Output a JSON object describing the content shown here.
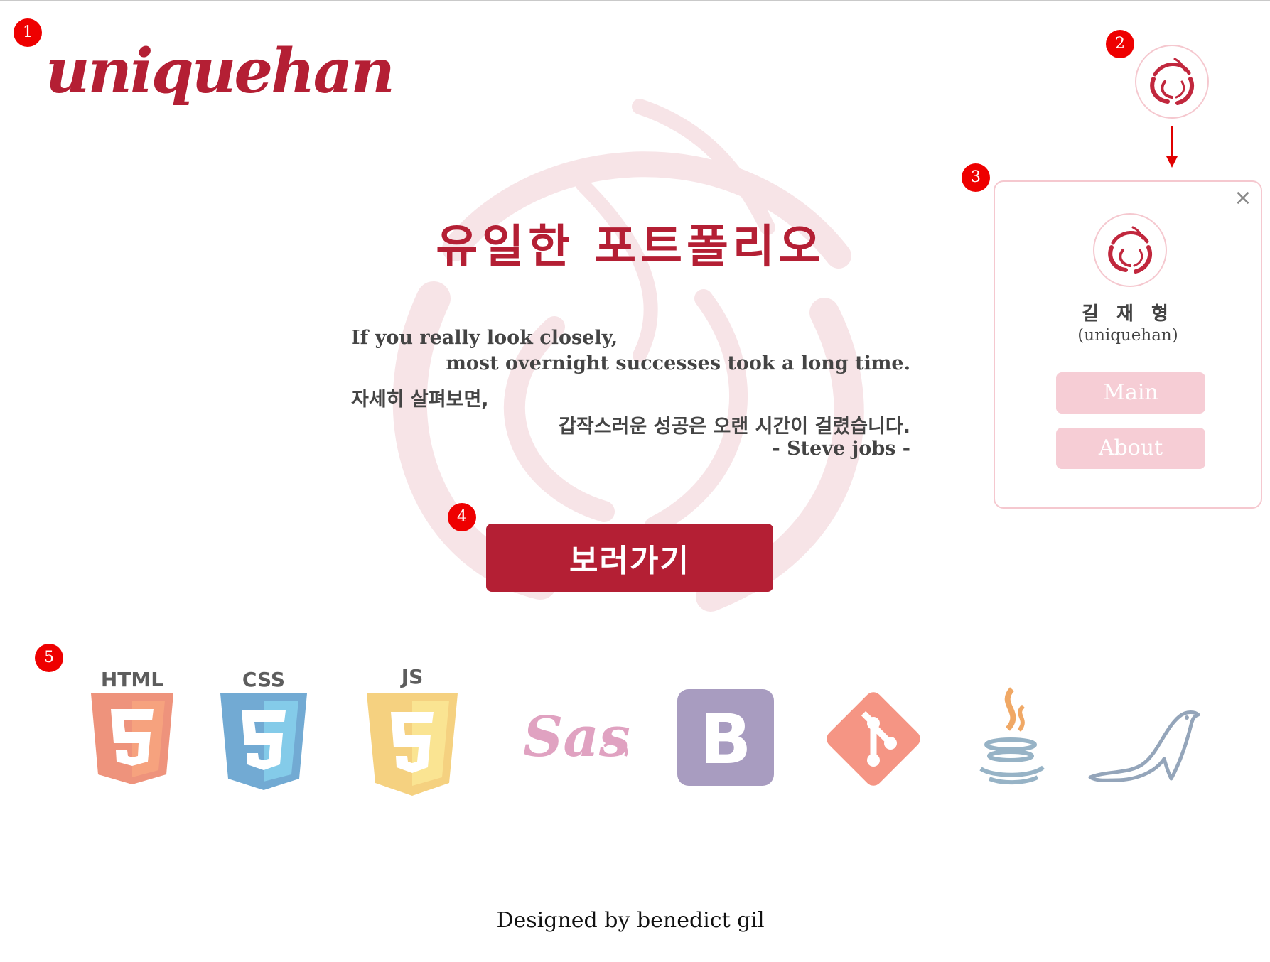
{
  "annotations": [
    "1",
    "2",
    "3",
    "4",
    "5"
  ],
  "header": {
    "logo_text": "uniquehan"
  },
  "profile": {
    "name": "길 재 형",
    "id": "(uniquehan)",
    "close_glyph": "×",
    "buttons": [
      "Main",
      "About"
    ]
  },
  "hero": {
    "title": "유일한 포트폴리오",
    "quote_en_line1": "If you really look closely,",
    "quote_en_line2": "most overnight successes took a long time.",
    "quote_ko_line1": "자세히 살펴보면,",
    "quote_ko_line2": "갑작스러운 성공은 오랜 시간이 걸렸습니다.",
    "quote_author": "- Steve jobs -",
    "cta_label": "보러가기"
  },
  "tech_stack": [
    {
      "name": "HTML",
      "icon": "html5-icon",
      "color": "#e44d26"
    },
    {
      "name": "CSS",
      "icon": "css3-icon",
      "color": "#1572b6"
    },
    {
      "name": "JS",
      "icon": "js-icon",
      "color": "#f0b32c"
    },
    {
      "name": "Sass",
      "icon": "sass-icon",
      "color": "#cc6699"
    },
    {
      "name": "B",
      "icon": "bootstrap-icon",
      "color": "#6f5b97"
    },
    {
      "name": "git",
      "icon": "git-icon",
      "color": "#f05033"
    },
    {
      "name": "java",
      "icon": "java-icon",
      "color": "#5382a1"
    },
    {
      "name": "mariadb",
      "icon": "mariadb-seal-icon",
      "color": "#4e6a8d"
    }
  ],
  "colors": {
    "brand": "#b41f34",
    "badge": "#ee0000",
    "soft_pink": "#f6cdd5"
  },
  "footer": {
    "text": "Designed by benedict gil"
  }
}
